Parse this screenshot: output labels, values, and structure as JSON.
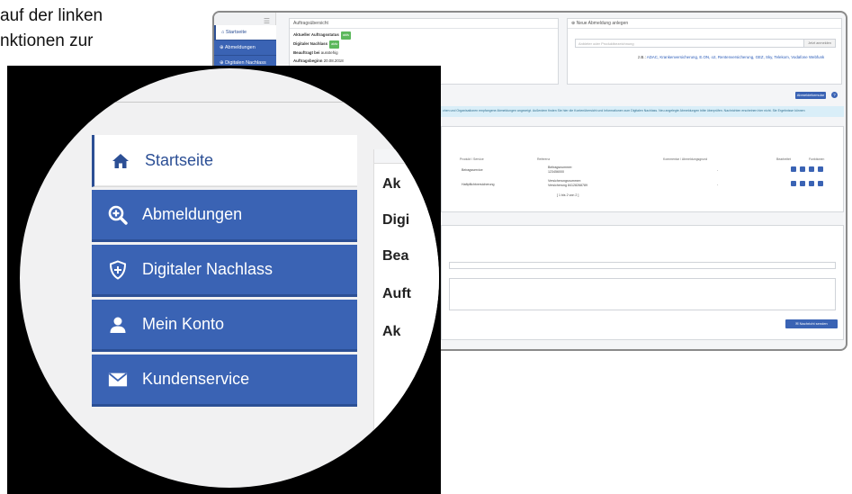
{
  "caption": {
    "line1": "auf der linken",
    "line2": "nktionen zur"
  },
  "background_app": {
    "sidebar": [
      {
        "label": "Startseite"
      },
      {
        "label": "Abmeldungen"
      },
      {
        "label": "Digitalen Nachlass"
      }
    ],
    "order_overview": {
      "title": "Auftragsübersicht",
      "rows": [
        {
          "label": "Aktueller Auftragsstatus",
          "tag": "aktiv"
        },
        {
          "label": "Digitaler Nachlass",
          "tag": "aktiv"
        },
        {
          "label": "Beauftragt bei",
          "value": "ausstehig"
        },
        {
          "label": "Auftragsbeginn",
          "value": "20.08.2018"
        }
      ]
    },
    "new_cancellation": {
      "title": "Neue Abmeldung anlegen",
      "search_placeholder": "Anbieter oder Produktbezeichnung",
      "search_button": "Jetzt anmelden",
      "examples_prefix": "z.B.:",
      "examples": "ADAC, Krankenversicherung, E.ON, o2, Rentenversicherung, GEZ, Sky, Telekom, Vodafone Webfunk"
    },
    "ticket_button": "Abmeldeformular",
    "help_icon_label": "?",
    "info_text": "chen und Organisationen empfangene Abmeldungen angezeigt. Außerdem finden Sie hier die Kontenübersicht und Informationen zum Digitalen Nachlass. Neu angelegte Abmeldungen bitte überprüfen. Nachrichten erscheinen hier nicht. Sie Ergebnisse können",
    "table": {
      "headers": [
        "Produkt / Service",
        "Referenz",
        "Kommentar / Abmeldungsgrund",
        "Bearbeitet",
        "Funktionen"
      ],
      "rows": [
        {
          "product": "Beiragsservice",
          "ref_label": "Beitragsnummer:",
          "ref_value": "123456000",
          "comment": "-"
        },
        {
          "product": "Haftpflichtversicherung",
          "ref_label": "Versicherungsnummer:",
          "ref_value": "Versicherung 84128268789",
          "comment": "-"
        }
      ],
      "pagination": "[ 1 bis 2 von 2 ]"
    },
    "send_button": "Nachricht senden"
  },
  "zoom_menu": {
    "items": [
      {
        "label": "Startseite",
        "icon": "home-icon",
        "active": true
      },
      {
        "label": "Abmeldungen",
        "icon": "search-plus-icon",
        "active": false
      },
      {
        "label": "Digitaler Nachlass",
        "icon": "shield-plus-icon",
        "active": false
      },
      {
        "label": "Mein Konto",
        "icon": "user-icon",
        "active": false
      },
      {
        "label": "Kundenservice",
        "icon": "envelope-icon",
        "active": false
      }
    ],
    "right_pane": [
      "Ak",
      "Digi",
      "Bea",
      "Auft",
      "Ak"
    ]
  },
  "colors": {
    "menu_blue": "#3a63b4",
    "menu_blue_dark": "#2c4f95",
    "tag_green": "#5cb85c",
    "circle_bg": "#f1f1f2"
  }
}
